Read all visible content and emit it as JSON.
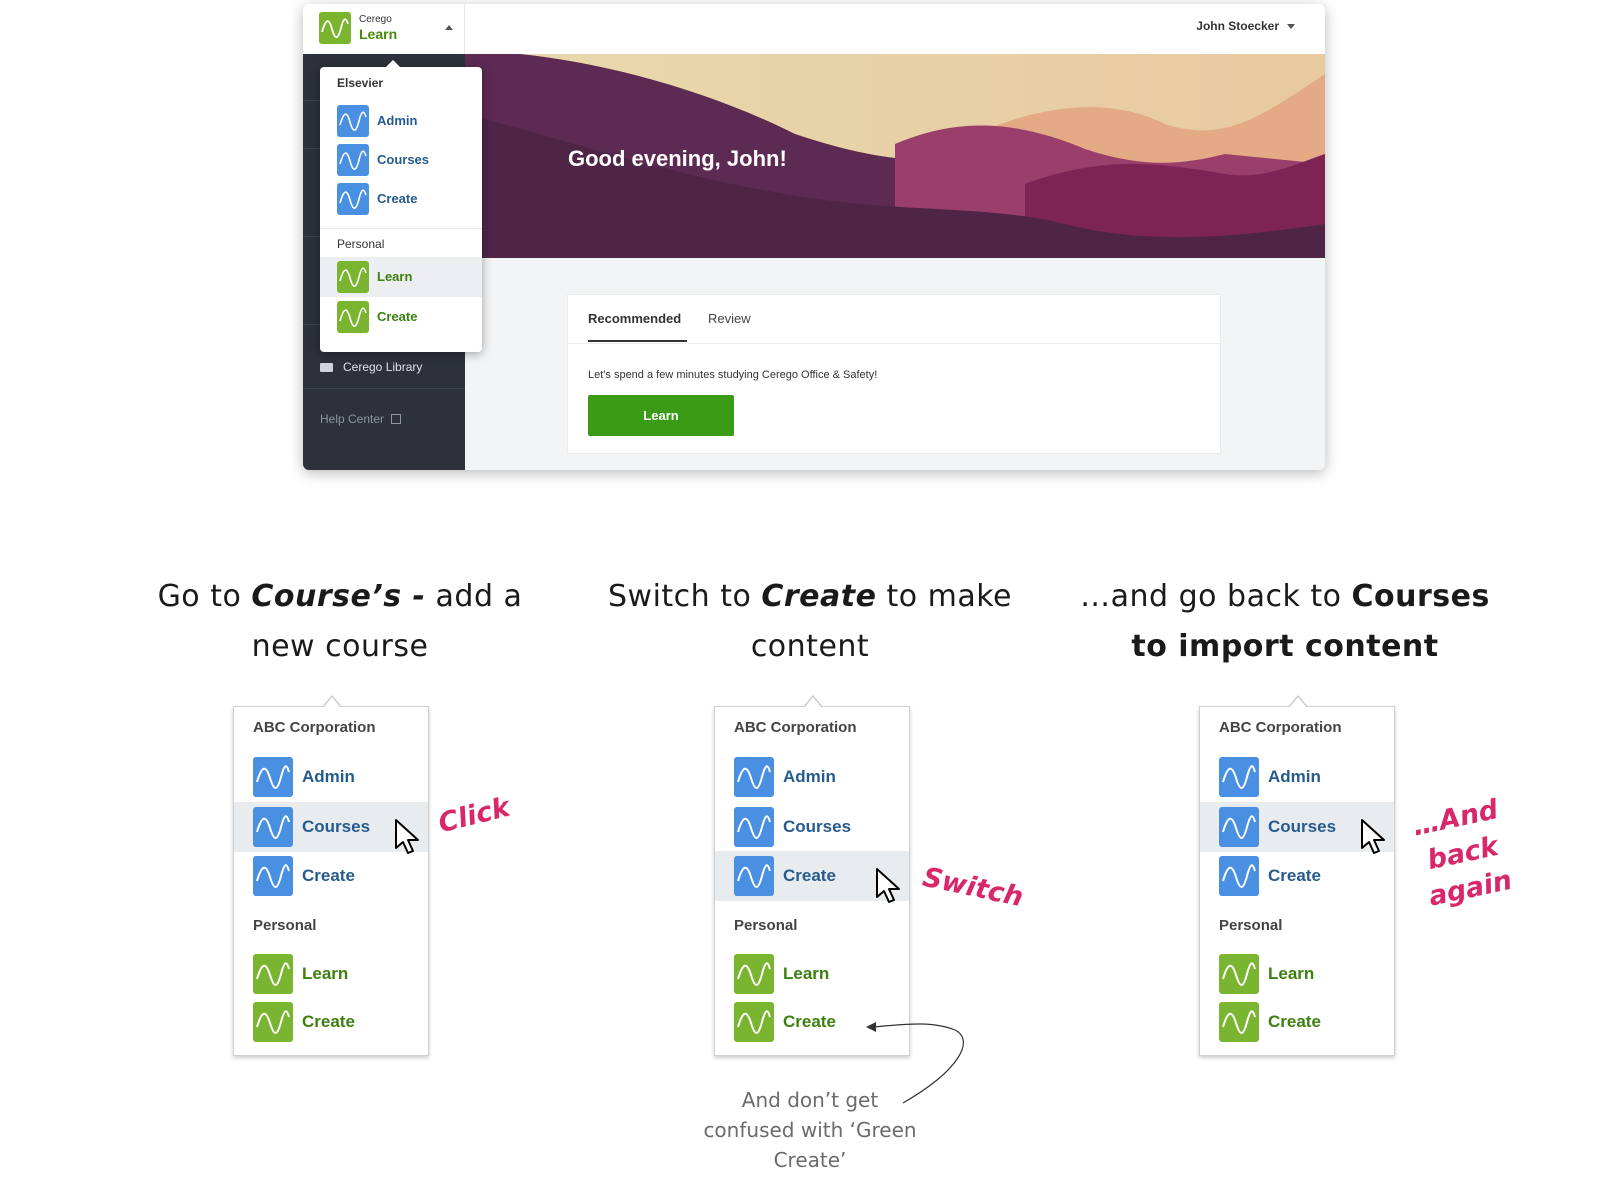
{
  "app": {
    "brand": "Cerego",
    "app_name": "Learn",
    "user_name": "John Stoecker",
    "greeting": "Good evening, John!",
    "sidebar": {
      "library": "Cerego Library",
      "help": "Help Center"
    },
    "tabs": [
      "Recommended",
      "Review"
    ],
    "card_message": "Let's spend a few minutes studying Cerego Office & Safety!",
    "learn_button": "Learn",
    "dropdown": {
      "org_title": "Elsevier",
      "org_items": [
        "Admin",
        "Courses",
        "Create"
      ],
      "personal_title": "Personal",
      "personal_items": [
        "Learn",
        "Create"
      ],
      "highlighted": "Learn"
    }
  },
  "colors": {
    "org_icon": "#4a90e2",
    "personal_icon": "#79b531",
    "hero": "#5a2b50",
    "accent": "#d8276b",
    "learn_button": "#3b9a16"
  },
  "steps": [
    {
      "caption": [
        "Go to ",
        "Course’s -",
        " add a new course"
      ],
      "note": "Click",
      "highlighted": "Courses"
    },
    {
      "caption": [
        "Switch to ",
        "Create",
        " to make content"
      ],
      "note": "Switch",
      "highlighted": "Create"
    },
    {
      "caption": [
        "…and go back to ",
        "Courses",
        " to import content"
      ],
      "note": "…And back again",
      "highlighted": "Courses"
    }
  ],
  "menu": {
    "org_title": "ABC Corporation",
    "org_items": [
      "Admin",
      "Courses",
      "Create"
    ],
    "personal_title": "Personal",
    "personal_items": [
      "Learn",
      "Create"
    ]
  },
  "hint": "And don’t get confused with ‘Green Create’",
  "icons": {
    "app_icon": "wave-logo-icon",
    "cursor": "mouse-pointer-icon",
    "folder": "folder-icon",
    "external": "external-link-icon"
  }
}
